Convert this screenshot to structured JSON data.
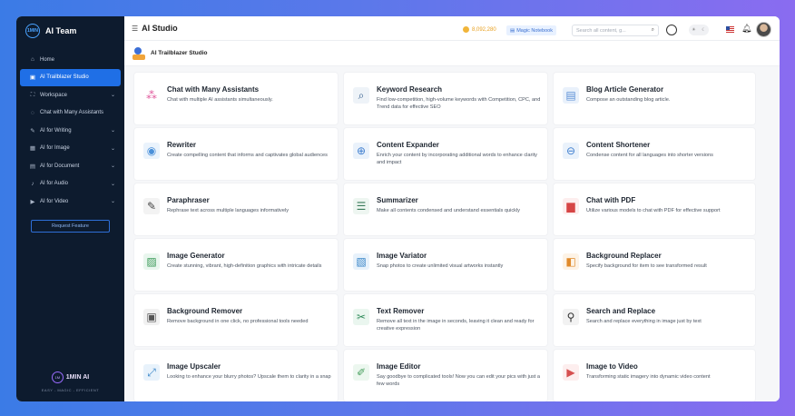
{
  "brand": {
    "name": "AI Team",
    "logo_text": "1MIN"
  },
  "sidebar": {
    "items": [
      {
        "label": "Home",
        "icon": "home-icon",
        "glyph": "⌂",
        "chevron": false,
        "active": false
      },
      {
        "label": "AI Trailblazer Studio",
        "icon": "studio-icon",
        "glyph": "▣",
        "chevron": false,
        "active": true
      },
      {
        "label": "Workspace",
        "icon": "workspace-icon",
        "glyph": "⛶",
        "chevron": true,
        "active": false
      },
      {
        "label": "Chat with Many Assistants",
        "icon": "chat-icon",
        "glyph": "◌",
        "chevron": false,
        "active": false
      },
      {
        "label": "AI for Writing",
        "icon": "pen-icon",
        "glyph": "✎",
        "chevron": true,
        "active": false
      },
      {
        "label": "AI for Image",
        "icon": "image-icon",
        "glyph": "▦",
        "chevron": true,
        "active": false
      },
      {
        "label": "AI for Document",
        "icon": "document-icon",
        "glyph": "▤",
        "chevron": true,
        "active": false
      },
      {
        "label": "AI for Audio",
        "icon": "audio-icon",
        "glyph": "♪",
        "chevron": true,
        "active": false
      },
      {
        "label": "AI for Video",
        "icon": "video-icon",
        "glyph": "▶",
        "chevron": true,
        "active": false
      }
    ],
    "request_label": "Request Feature",
    "footer_brand": "1MIN AI",
    "footer_badge": "1M",
    "footer_tagline": "EASY - MAGIC - EFFICIENT"
  },
  "header": {
    "title": "AI Studio",
    "credits": "8,092,280",
    "magic_label": "Magic Notebook",
    "search_placeholder": "Search all content, g...",
    "toggle_left": "☀",
    "toggle_right": "☾"
  },
  "section": {
    "title": "AI Trailblazer Studio"
  },
  "tools": [
    {
      "name": "Chat with Many Assistants",
      "desc": "Chat with multiple AI assistants simultaneously.",
      "icon": "multi-chat-icon",
      "glyph": "⁂",
      "color": "#e0559a",
      "bg": "#fff"
    },
    {
      "name": "Keyword Research",
      "desc": "Find low-competition, high-volume keywords with Competition, CPC, and Trend data for effective SEO",
      "icon": "keyword-search-icon",
      "glyph": "⌕",
      "color": "#2f5a8a",
      "bg": "#eef3f8"
    },
    {
      "name": "Blog Article Generator",
      "desc": "Compose an outstanding blog article.",
      "icon": "blog-icon",
      "glyph": "▤",
      "color": "#5b8fd6",
      "bg": "#e9f1fb"
    },
    {
      "name": "Rewriter",
      "desc": "Create compelling content that informs and captivates global audiences",
      "icon": "rewriter-icon",
      "glyph": "◉",
      "color": "#4a90d9",
      "bg": "#eaf3fc"
    },
    {
      "name": "Content Expander",
      "desc": "Enrich your content by incorporating additional words to enhance clarity and impact",
      "icon": "expander-icon",
      "glyph": "⊕",
      "color": "#3f7ecf",
      "bg": "#eaf2fb"
    },
    {
      "name": "Content Shortener",
      "desc": "Condense content for all languages into shorter versions",
      "icon": "shortener-icon",
      "glyph": "⊖",
      "color": "#3f7ecf",
      "bg": "#eaf2fb"
    },
    {
      "name": "Paraphraser",
      "desc": "Rephrase text across multiple languages informatively",
      "icon": "paraphraser-icon",
      "glyph": "✎",
      "color": "#444",
      "bg": "#f3f3f3"
    },
    {
      "name": "Summarizer",
      "desc": "Make all contents condensed and understand essentials quickly",
      "icon": "summarizer-icon",
      "glyph": "☰",
      "color": "#3a7a5a",
      "bg": "#eef6f1"
    },
    {
      "name": "Chat with PDF",
      "desc": "Utilize various models to chat with PDF for effective support",
      "icon": "pdf-icon",
      "glyph": "▆",
      "color": "#d64545",
      "bg": "#fdeeee"
    },
    {
      "name": "Image Generator",
      "desc": "Create stunning, vibrant, high-definition graphics with intricate details",
      "icon": "image-generator-icon",
      "glyph": "▨",
      "color": "#3d9b5a",
      "bg": "#e9f6ee"
    },
    {
      "name": "Image Variator",
      "desc": "Snap photos to create unlimited visual artworks instantly",
      "icon": "image-variator-icon",
      "glyph": "▧",
      "color": "#3a86c8",
      "bg": "#e8f2fb"
    },
    {
      "name": "Background Replacer",
      "desc": "Specify background for item to see transformed result",
      "icon": "background-replacer-icon",
      "glyph": "◧",
      "color": "#e08a2a",
      "bg": "#fdf3e6"
    },
    {
      "name": "Background Remover",
      "desc": "Remove background in one click, no professional tools needed",
      "icon": "background-remover-icon",
      "glyph": "▣",
      "color": "#555",
      "bg": "#f1f1f1"
    },
    {
      "name": "Text Remover",
      "desc": "Remove all text in the image in seconds, leaving it clean and ready for creative expression",
      "icon": "text-remover-icon",
      "glyph": "✂",
      "color": "#2f8a5a",
      "bg": "#eaf6ef"
    },
    {
      "name": "Search and Replace",
      "desc": "Search and replace everything in image just by text",
      "icon": "search-replace-icon",
      "glyph": "⚲",
      "color": "#333",
      "bg": "#f2f2f2"
    },
    {
      "name": "Image Upscaler",
      "desc": "Looking to enhance your blurry photos? Upscale them to clarity in a snap",
      "icon": "image-upscaler-icon",
      "glyph": "⤢",
      "color": "#3a86c8",
      "bg": "#e8f2fb"
    },
    {
      "name": "Image Editor",
      "desc": "Say goodbye to complicated tools! Now you can edit your pics with just a few words",
      "icon": "image-editor-icon",
      "glyph": "✐",
      "color": "#4aa060",
      "bg": "#ecf7ef"
    },
    {
      "name": "Image to Video",
      "desc": "Transforming static imagery into dynamic video content",
      "icon": "image-to-video-icon",
      "glyph": "▶",
      "color": "#d65050",
      "bg": "#fdeeee"
    }
  ]
}
